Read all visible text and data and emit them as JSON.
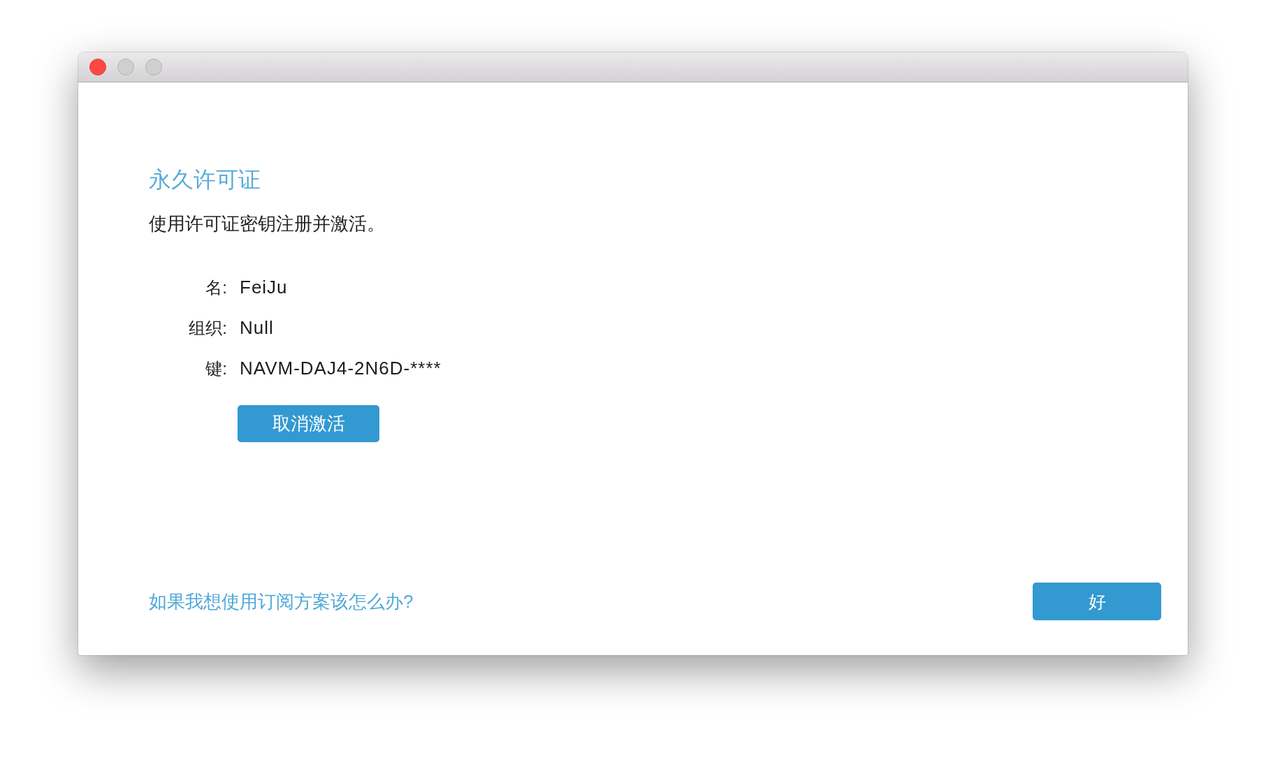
{
  "window": {
    "controls": [
      {
        "kind": "close",
        "disabled": false
      },
      {
        "kind": "minimize",
        "disabled": true
      },
      {
        "kind": "zoom",
        "disabled": true
      }
    ]
  },
  "license": {
    "title": "永久许可证",
    "description": "使用许可证密钥注册并激活。",
    "fields": [
      {
        "label": "名:",
        "value": "FeiJu"
      },
      {
        "label": "组织:",
        "value": "Null"
      },
      {
        "label": "键:",
        "value": "NAVM-DAJ4-2N6D-****"
      }
    ],
    "deactivate_button": "取消激活"
  },
  "footer": {
    "link": "如果我想使用订阅方案该怎么办?",
    "ok_button": "好"
  }
}
